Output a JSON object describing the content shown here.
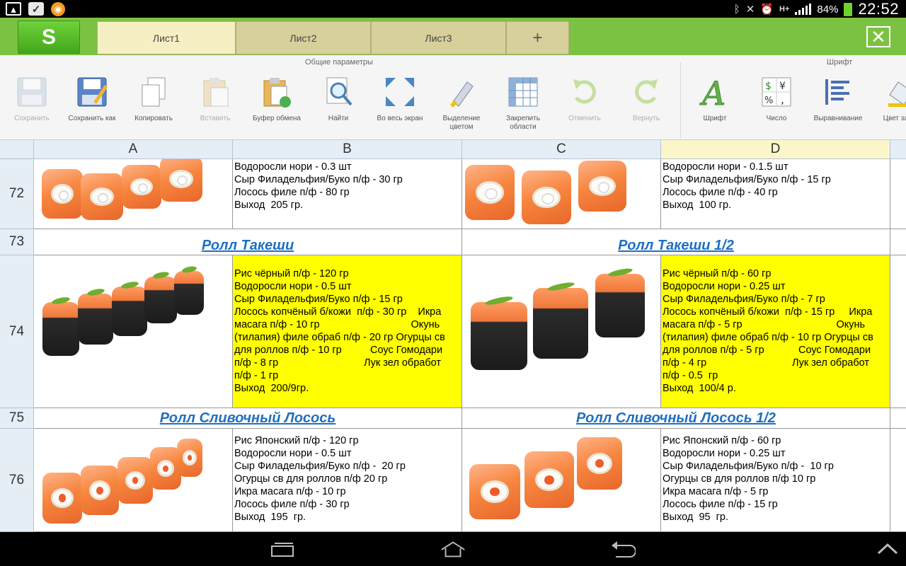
{
  "status_bar": {
    "battery": "84%",
    "clock": "22:52",
    "network": "H+"
  },
  "app": {
    "logo": "S"
  },
  "tabs": [
    {
      "label": "Лист1",
      "active": true
    },
    {
      "label": "Лист2",
      "active": false
    },
    {
      "label": "Лист3",
      "active": false
    }
  ],
  "add_tab": "+",
  "close": "✕",
  "ribbon": {
    "group_general": "Общие параметры",
    "group_font": "Шрифт",
    "buttons": {
      "save": "Сохранить",
      "save_as": "Сохранить как",
      "copy": "Копировать",
      "paste": "Вставить",
      "clipboard": "Буфер обмена",
      "find": "Найти",
      "fullscreen": "Во весь экран",
      "highlight": "Выделение цветом",
      "freeze": "Закрепить области",
      "undo": "Отменить",
      "redo": "Вернуть",
      "font": "Шрифт",
      "number": "Число",
      "align": "Выравнивание",
      "fill": "Цвет зали"
    }
  },
  "columns": [
    "A",
    "B",
    "C",
    "D"
  ],
  "rows": {
    "r72": "72",
    "r73": "73",
    "r74": "74",
    "r75": "75",
    "r76": "76"
  },
  "cells": {
    "B72": "Водоросли нори - 0.3 шт\nСыр Филадельфия/Буко п/ф - 30 гр\nЛосось филе п/ф - 80 гр\nВыход  205 гр.",
    "D72": "Водоросли нори - 0.1.5 шт\nСыр Филадельфия/Буко п/ф - 15 гр\nЛосось филе п/ф - 40 гр\nВыход  100 гр.",
    "AB73": "Ролл Такеши",
    "CD73": "Ролл Такеши 1/2",
    "B74": "Рис чёрный п/ф - 120 гр\nВодоросли нори - 0.5 шт\nСыр Филадельфия/Буко п/ф - 15 гр\nЛосось копчёный б/кожи  п/ф - 30 гр    Икра\nмасага п/ф - 10 гр                                Окунь\n(тилапия) филе обраб п/ф - 20 гр Огурцы св\nдля роллов п/ф - 10 гр          Соус Гомодари\nп/ф - 8 гр                              Лук зел обработ\nп/ф - 1 гр\nВыход  200/9гр.",
    "D74": "Рис чёрный п/ф - 60 гр\nВодоросли нори - 0.25 шт\nСыр Филадельфия/Буко п/ф - 7 гр\nЛосось копчёный б/кожи  п/ф - 15 гр     Икра\nмасага п/ф - 5 гр                                 Окунь\n(тилапия) филе обраб п/ф - 10 гр Огурцы св\nдля роллов п/ф - 5 гр            Соус Гомодари\nп/ф - 4 гр                              Лук зел обработ\nп/ф - 0.5  гр\nВыход  100/4 р.",
    "AB75": "Ролл Сливочный Лосось ",
    "CD75": "Ролл Сливочный Лосось 1/2",
    "B76": "Рис Японский п/ф - 120 гр\nВодоросли нори - 0.5 шт\nСыр Филадельфия/Буко п/ф -  20 гр\nОгурцы св для роллов п/ф 20 гр\nИкра масага п/ф - 10 гр\nЛосось филе п/ф - 30 гр\nВыход  195  гр.",
    "D76": "Рис Японский п/ф - 60 гр\nВодоросли нори - 0.25 шт\nСыр Филадельфия/Буко п/ф -  10 гр\nОгурцы св для роллов п/ф 10 гр\nИкра масага п/ф - 5 гр\nЛосось филе п/ф - 15 гр\nВыход  95  гр."
  },
  "colors": {
    "tabbar": "#7cc242",
    "highlight_yellow": "#ffff00",
    "title_link": "#1f6fc1"
  }
}
